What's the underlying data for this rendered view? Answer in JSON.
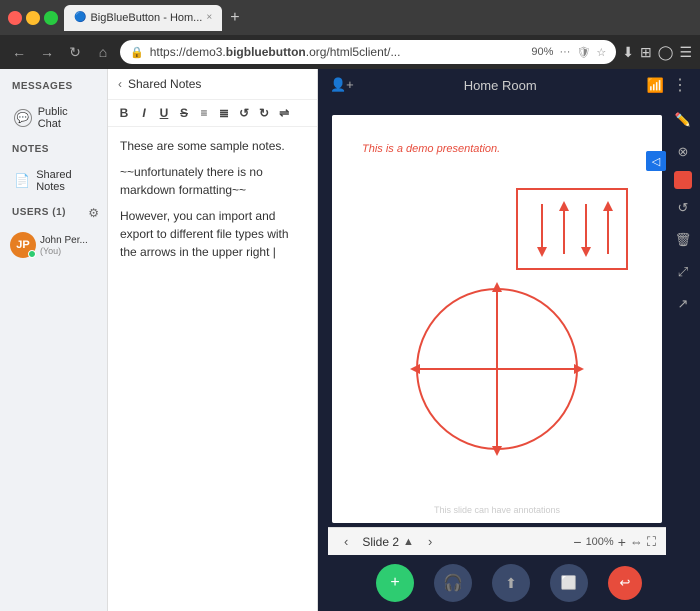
{
  "browser": {
    "tab_title": "BigBlueButton - Hom...",
    "tab_favicon": "🔵",
    "address": "https://demo3.bigbluebutton.org/html5client/...",
    "address_short": "demo3.",
    "address_bold": "bigbluebutton",
    "address_rest": ".org/html5client/...",
    "zoom": "90%",
    "new_tab_label": "+",
    "nav_back": "←",
    "nav_forward": "→",
    "nav_refresh": "↻",
    "nav_home": "⌂"
  },
  "sidebar": {
    "messages_label": "MESSAGES",
    "public_chat_label": "Public Chat",
    "notes_label": "NOTES",
    "shared_notes_label": "Shared Notes",
    "users_label": "USERS",
    "users_count": "(1)",
    "user_name": "John Per...",
    "user_you": "(You)"
  },
  "notes": {
    "title": "Shared Notes",
    "back_icon": "‹",
    "toolbar": {
      "bold": "B",
      "italic": "I",
      "underline": "U",
      "strikethrough": "S",
      "ordered_list": "≡",
      "unordered_list": "≣",
      "undo": "↺",
      "redo": "↻",
      "import_export": "⇌"
    },
    "content_line1": "These are some sample notes.",
    "content_line2": "~~unfortunately there is no markdown formatting~~",
    "content_line3": "However, you can import and export to different file types with the arrows in the upper right |"
  },
  "presentation": {
    "room_title": "Home Room",
    "slide_demo_text": "This is a demo presentation.",
    "slide_watermark": "This slide can have annotations",
    "slide_number": "Slide 2",
    "zoom_level": "100%"
  },
  "drawing_tools": {
    "pencil": "✏",
    "eraser": "⊘",
    "undo": "↺",
    "trash": "🗑",
    "fit": "⤢",
    "export": "↗"
  },
  "bottom_toolbar": {
    "plus": "+",
    "mic": "🎧",
    "share_screen": "⤴",
    "camera": "📷",
    "end": "↩"
  },
  "colors": {
    "bg_dark": "#1a2035",
    "bg_sidebar": "#f0f2f5",
    "accent_blue": "#1a73e8",
    "accent_green": "#2ecc71",
    "accent_red": "#e74c3c",
    "draw_color": "#e74c3c"
  }
}
